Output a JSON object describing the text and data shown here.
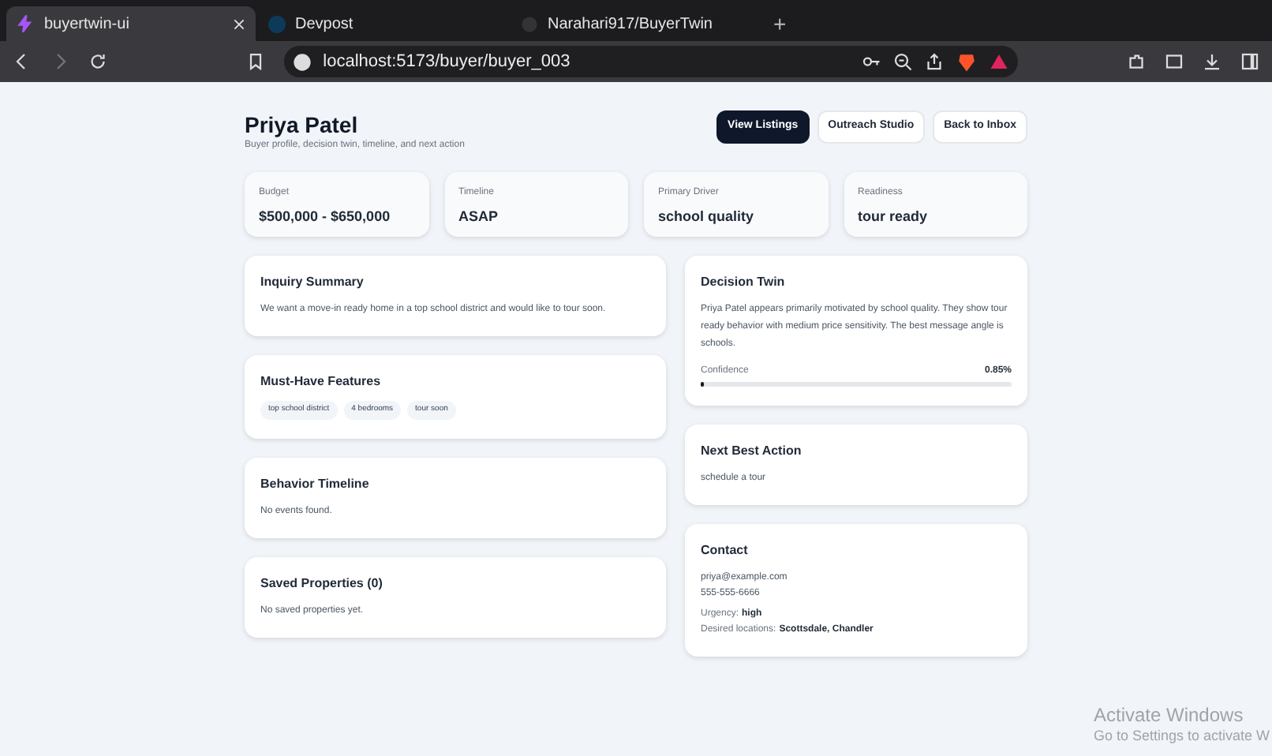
{
  "browser": {
    "tabs": [
      {
        "title": "buyertwin-ui",
        "selected": true,
        "closable": true
      },
      {
        "title": "Devpost",
        "selected": false,
        "closable": false
      },
      {
        "title": "Narahari917/BuyerTwin",
        "selected": false,
        "closable": false
      }
    ],
    "new_tab": "+",
    "url": "localhost:5173/buyer/buyer_003"
  },
  "header": {
    "name": "Priya Patel",
    "subtitle": "Buyer profile, decision twin, timeline, and next action",
    "buttons": [
      {
        "label": "View Listings",
        "primary": true
      },
      {
        "label": "Outreach Studio",
        "primary": false
      },
      {
        "label": "Back to Inbox",
        "primary": false
      }
    ]
  },
  "stats": [
    {
      "label": "Budget",
      "value": "$500,000 - $650,000"
    },
    {
      "label": "Timeline",
      "value": "ASAP"
    },
    {
      "label": "Primary Driver",
      "value": "school quality"
    },
    {
      "label": "Readiness",
      "value": "tour ready"
    }
  ],
  "left_cards": [
    {
      "title": "Inquiry Summary",
      "text": "We want a move-in ready home in a top school district and would like to tour soon."
    },
    {
      "title": "Must-Have Features",
      "tags": [
        "top school district",
        "4 bedrooms",
        "tour soon"
      ]
    },
    {
      "title": "Behavior Timeline",
      "text": "No events found."
    },
    {
      "title": "Saved Properties (0)",
      "text": "No saved properties yet."
    }
  ],
  "decision_twin": {
    "title": "Decision Twin",
    "text": "Priya Patel appears primarily motivated by school quality. They show tour ready behavior with medium price sensitivity. The best message angle is schools.",
    "confidence_label": "Confidence",
    "confidence_value": "0.85%",
    "level": 0.0085
  },
  "next_best_action": {
    "title": "Next Best Action",
    "text": "schedule a tour"
  },
  "contact": {
    "title": "Contact",
    "email": "priya@example.com",
    "phone": "555-555-6666",
    "urgency_label": "Urgency:",
    "urgency": "high",
    "locations_label": "Desired locations:",
    "locations": "Scottsdale, Chandler"
  },
  "os_notice": {
    "title": "Activate Windows",
    "text": "Go to Settings to activate W"
  }
}
